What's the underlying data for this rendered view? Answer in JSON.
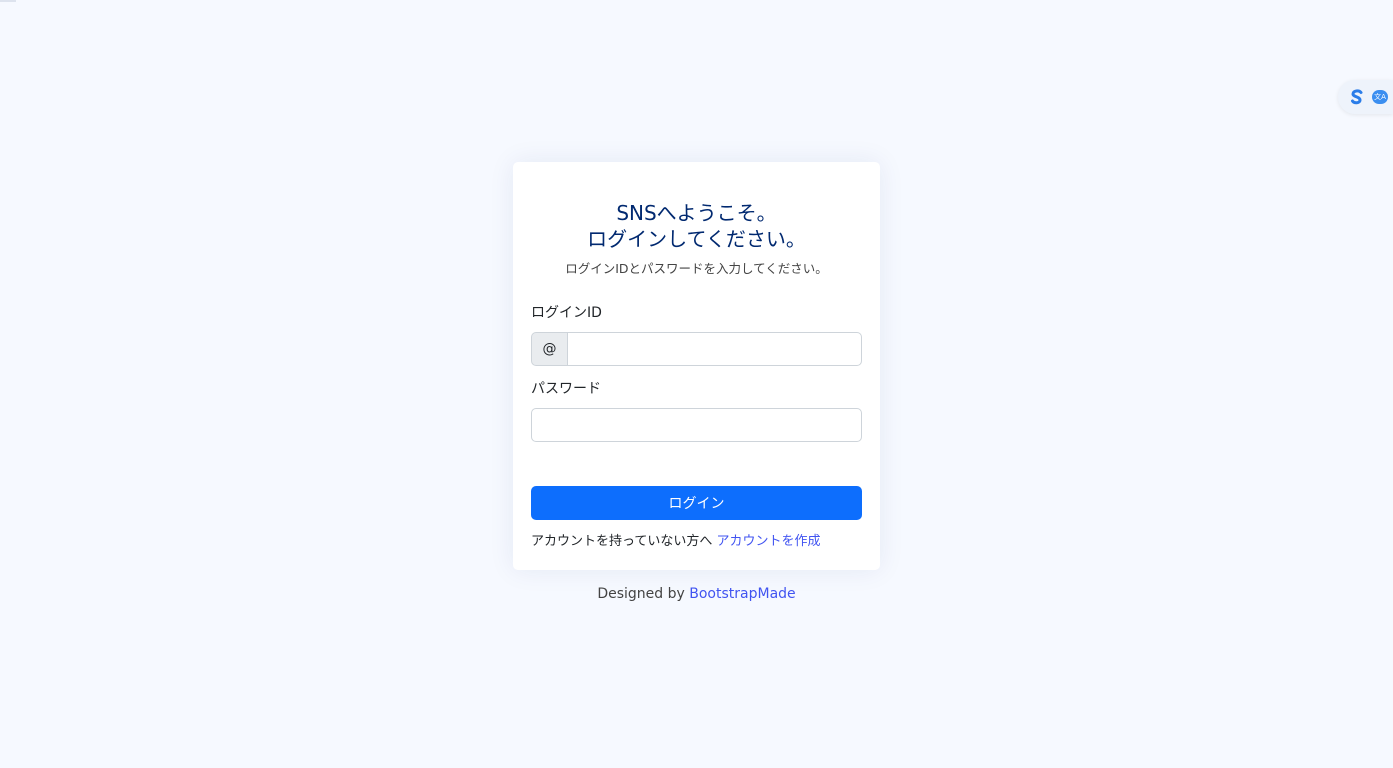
{
  "colors": {
    "background": "#f6f9ff",
    "title": "#012970",
    "primary_button": "#0d6efd",
    "link": "#4154f1"
  },
  "login": {
    "title_line1": "SNSへようこそ。",
    "title_line2": "ログインしてください。",
    "subtitle": "ログインIDとパスワードを入力してください。",
    "login_id_label": "ログインID",
    "login_id_prefix": "@",
    "login_id_value": "",
    "password_label": "パスワード",
    "password_value": "",
    "submit_label": "ログイン",
    "signup_text": "アカウントを持っていない方へ",
    "signup_link": "アカウントを作成"
  },
  "footer": {
    "designed_by": "Designed by",
    "credit_link": "BootstrapMade"
  },
  "widget": {
    "icons": [
      "s-logo-icon",
      "translate-icon"
    ],
    "translate_glyph": "文A"
  }
}
